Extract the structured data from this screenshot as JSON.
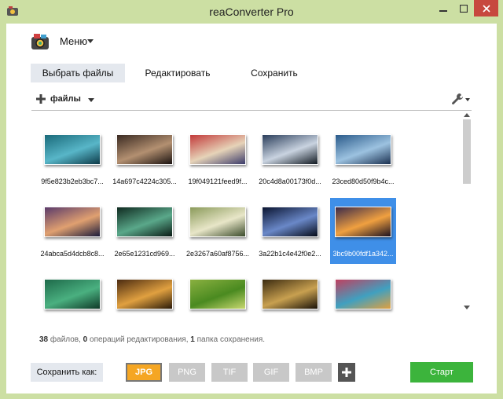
{
  "window": {
    "title": "reaConverter Pro",
    "frame_color": "#ccdfa3",
    "close_color": "#c7483e"
  },
  "menu": {
    "label": "Меню"
  },
  "tabs": [
    {
      "label": "Выбрать файлы",
      "active": true
    },
    {
      "label": "Редактировать",
      "active": false
    },
    {
      "label": "Сохранить",
      "active": false
    }
  ],
  "toolbar": {
    "files_label": "файлы"
  },
  "files": [
    {
      "name": "9f5e823b2eb3bc7...",
      "selected": false,
      "colors": [
        "#1a6a7a",
        "#58b6c8",
        "#0d3a48"
      ]
    },
    {
      "name": "14a697c4224c305...",
      "selected": false,
      "colors": [
        "#3a2a22",
        "#b39071",
        "#1a1210"
      ]
    },
    {
      "name": "19f049121feed9f...",
      "selected": false,
      "colors": [
        "#c23a3a",
        "#e6d3b8",
        "#3a3a6a"
      ]
    },
    {
      "name": "20c4d8a00173f0d...",
      "selected": false,
      "colors": [
        "#2a3d5a",
        "#c9d3e0",
        "#101820"
      ]
    },
    {
      "name": "23ced80d50f9b4c...",
      "selected": false,
      "colors": [
        "#2a5a8a",
        "#9cc2e0",
        "#1a3050"
      ]
    },
    {
      "name": "24abca5d4dcb8c8...",
      "selected": false,
      "colors": [
        "#5a3a6a",
        "#e0a070",
        "#1a1a3a"
      ]
    },
    {
      "name": "2e65e1231cd969...",
      "selected": false,
      "colors": [
        "#0f2a20",
        "#5aa88a",
        "#0a1a14"
      ]
    },
    {
      "name": "2e3267a60af8756...",
      "selected": false,
      "colors": [
        "#8a9a5a",
        "#e8e6c8",
        "#3a4a2a"
      ]
    },
    {
      "name": "3a22b1c4e42f0e2...",
      "selected": false,
      "colors": [
        "#0a1430",
        "#6a88c8",
        "#050a18"
      ]
    },
    {
      "name": "3bc9b00fdf1a342...",
      "selected": true,
      "colors": [
        "#3a2a4a",
        "#f0a040",
        "#1a1020"
      ]
    },
    {
      "name": "",
      "selected": false,
      "colors": [
        "#1e6a4a",
        "#4ab080",
        "#0f3a28"
      ]
    },
    {
      "name": "",
      "selected": false,
      "colors": [
        "#4a2a10",
        "#e0a040",
        "#2a1a08"
      ]
    },
    {
      "name": "",
      "selected": false,
      "colors": [
        "#8ab040",
        "#4a8a20",
        "#c8d870"
      ]
    },
    {
      "name": "",
      "selected": false,
      "colors": [
        "#3a2a10",
        "#c8a050",
        "#1a1208"
      ]
    },
    {
      "name": "",
      "selected": false,
      "colors": [
        "#c04060",
        "#40a0c0",
        "#e0a040"
      ]
    }
  ],
  "status": {
    "files_count": "38",
    "files_text": "файлов,",
    "edits_count": "0",
    "edits_text": "операций редактирования,",
    "folders_count": "1",
    "folders_text": "папка сохранения."
  },
  "save_as": {
    "label": "Сохранить как:"
  },
  "formats": [
    {
      "label": "JPG",
      "active": true,
      "color": "#f5a623"
    },
    {
      "label": "PNG",
      "active": false
    },
    {
      "label": "TIF",
      "active": false
    },
    {
      "label": "GIF",
      "active": false
    },
    {
      "label": "BMP",
      "active": false
    }
  ],
  "start_button": {
    "label": "Старт",
    "color": "#3cb43c"
  }
}
